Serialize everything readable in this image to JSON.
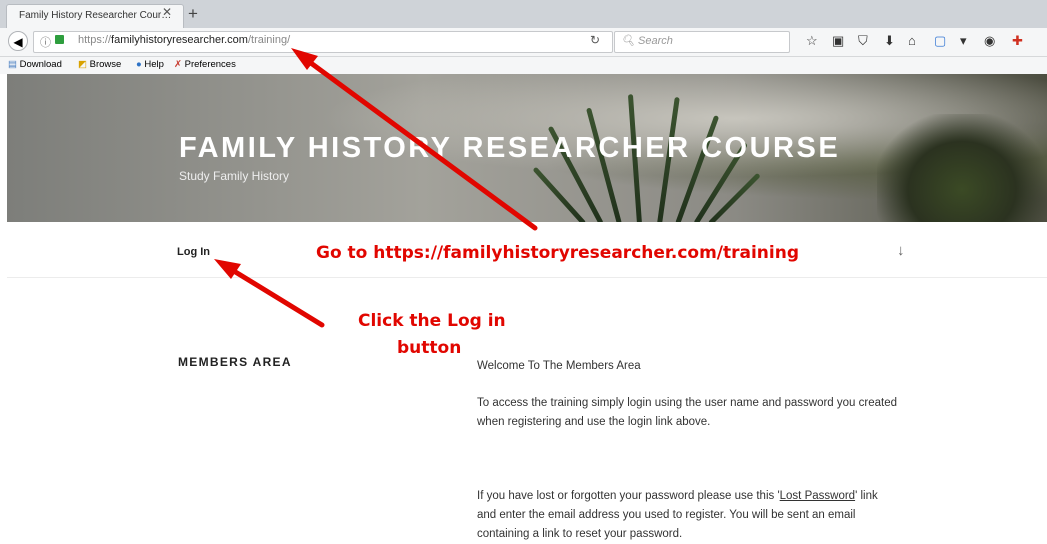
{
  "browser": {
    "tab_title": "Family History Researcher Cour…",
    "url_prefix": "https://",
    "url_domain": "familyhistoryresearcher.com",
    "url_path": "/training/",
    "search_placeholder": "Search"
  },
  "bookmarks": [
    {
      "label": "Download"
    },
    {
      "label": "Browse"
    },
    {
      "label": "Help"
    },
    {
      "label": "Preferences"
    }
  ],
  "site": {
    "title": "FAMILY HISTORY RESEARCHER COURSE",
    "tagline": "Study Family History",
    "nav_login": "Log In",
    "section_title": "MEMBERS AREA",
    "welcome": "Welcome To The Members Area",
    "access_text": "To access the training simply login using the user name and password you created when registering and use the login link above.",
    "lost_pre": "If you have lost or forgotten your password please use this '",
    "lost_link": "Lost Password",
    "lost_post": "' link and enter the email address you used to register. You will be sent an email containing a link to reset your password."
  },
  "annotations": {
    "goto": "Go to https://familyhistoryresearcher.com/training",
    "click_line1": "Click the Log in",
    "click_line2": "button"
  },
  "colors": {
    "annotation": "#e10600",
    "lock": "#2e9e3e"
  }
}
